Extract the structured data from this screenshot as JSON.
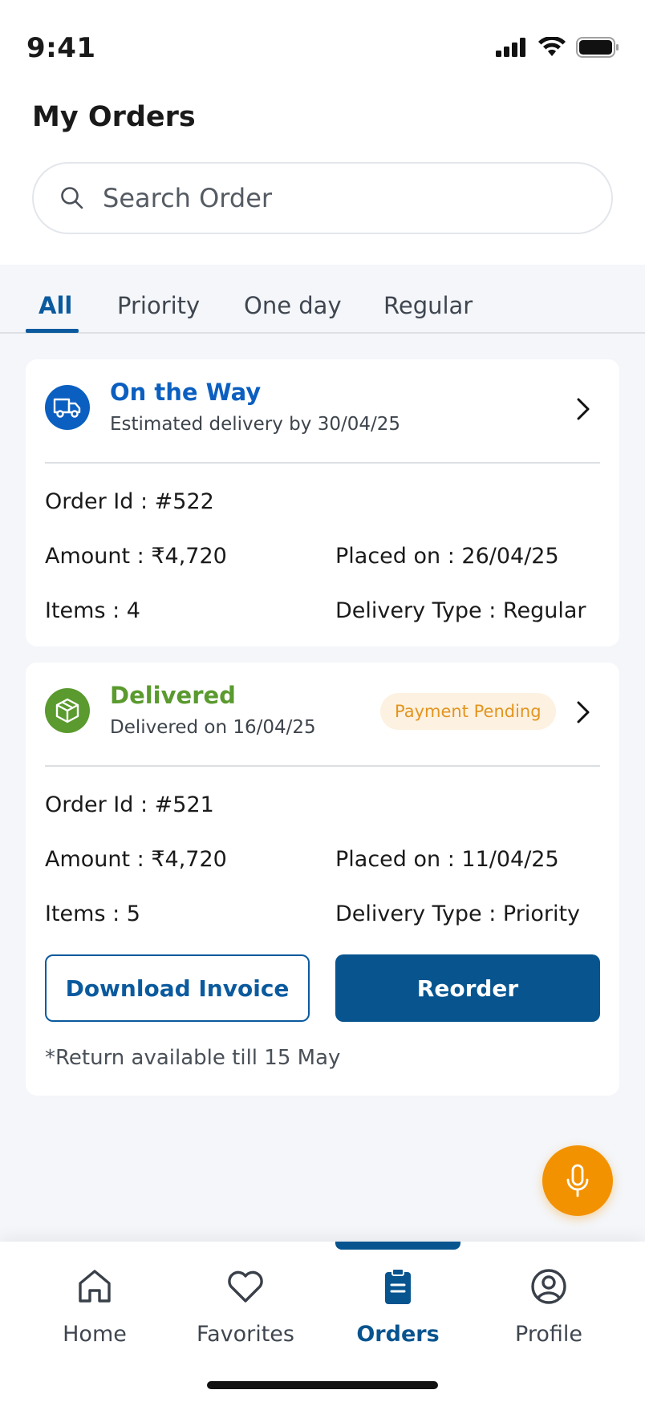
{
  "status_bar": {
    "time": "9:41"
  },
  "header": {
    "title": "My Orders"
  },
  "search": {
    "placeholder": "Search Order"
  },
  "tabs": [
    {
      "label": "All",
      "active": true
    },
    {
      "label": "Priority",
      "active": false
    },
    {
      "label": "One day",
      "active": false
    },
    {
      "label": "Regular",
      "active": false
    }
  ],
  "orders": [
    {
      "status": "On the Way",
      "status_color": "#0b5fc0",
      "icon": "truck-icon",
      "subtitle": "Estimated delivery by 30/04/25",
      "order_id": "Order Id : #522",
      "amount": "Amount : ₹4,720",
      "placed_on": "Placed on : 26/04/25",
      "items": "Items : 4",
      "delivery_type": "Delivery Type : Regular"
    },
    {
      "status": "Delivered",
      "status_color": "#5a9a2e",
      "icon": "package-icon",
      "subtitle": "Delivered on 16/04/25",
      "badge": "Payment Pending",
      "order_id": "Order Id : #521",
      "amount": "Amount : ₹4,720",
      "placed_on": "Placed on : 11/04/25",
      "items": "Items : 5",
      "delivery_type": "Delivery Type : Priority",
      "download_label": "Download Invoice",
      "reorder_label": "Reorder",
      "return_note": "*Return available till 15 May"
    }
  ],
  "bottom_nav": [
    {
      "label": "Home",
      "icon": "home-icon",
      "active": false
    },
    {
      "label": "Favorites",
      "icon": "heart-icon",
      "active": false
    },
    {
      "label": "Orders",
      "icon": "clipboard-icon",
      "active": true
    },
    {
      "label": "Profile",
      "icon": "user-circle-icon",
      "active": false
    }
  ],
  "colors": {
    "primary": "#07548f",
    "accent": "#f39200",
    "badge_text": "#e2951e"
  }
}
